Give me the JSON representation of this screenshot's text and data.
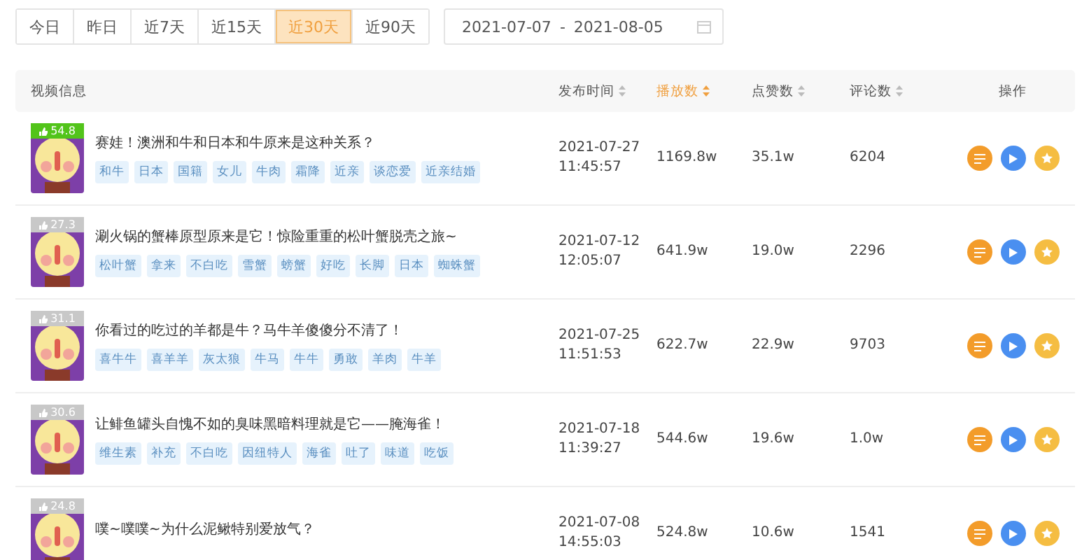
{
  "range_tabs": [
    {
      "label": "今日",
      "selected": false
    },
    {
      "label": "昨日",
      "selected": false
    },
    {
      "label": "近7天",
      "selected": false
    },
    {
      "label": "近15天",
      "selected": false
    },
    {
      "label": "近30天",
      "selected": true
    },
    {
      "label": "近90天",
      "selected": false
    }
  ],
  "date_range": {
    "start": "2021-07-07",
    "separator": "-",
    "end": "2021-08-05"
  },
  "table": {
    "columns": [
      {
        "label": "视频信息",
        "sortable": false,
        "selected": false
      },
      {
        "label": "发布时间",
        "sortable": true,
        "selected": false
      },
      {
        "label": "播放数",
        "sortable": true,
        "selected": true
      },
      {
        "label": "点赞数",
        "sortable": true,
        "selected": false
      },
      {
        "label": "评论数",
        "sortable": true,
        "selected": false
      },
      {
        "label": "操作",
        "sortable": false,
        "selected": false
      }
    ],
    "rows": [
      {
        "score": "54.8",
        "color": "#52c41a",
        "title": "赛娃！澳洲和牛和日本和牛原来是这种关系？",
        "tags": [
          "和牛",
          "日本",
          "国籍",
          "女儿",
          "牛肉",
          "霜降",
          "近亲",
          "谈恋爱",
          "近亲结婚"
        ],
        "date": "2021-07-27",
        "time": "11:45:57",
        "plays": "1169.8w",
        "likes": "35.1w",
        "comments": "6204"
      },
      {
        "score": "27.3",
        "color": "#c8c8c8",
        "title": "涮火锅的蟹棒原型原来是它！惊险重重的松叶蟹脱壳之旅~",
        "tags": [
          "松叶蟹",
          "拿来",
          "不白吃",
          "雪蟹",
          "螃蟹",
          "好吃",
          "长脚",
          "日本",
          "蜘蛛蟹"
        ],
        "date": "2021-07-12",
        "time": "12:05:07",
        "plays": "641.9w",
        "likes": "19.0w",
        "comments": "2296"
      },
      {
        "score": "31.1",
        "color": "#c8c8c8",
        "title": "你看过的吃过的羊都是牛？马牛羊傻傻分不清了！",
        "tags": [
          "喜牛牛",
          "喜羊羊",
          "灰太狼",
          "牛马",
          "牛牛",
          "勇敢",
          "羊肉",
          "牛羊"
        ],
        "date": "2021-07-25",
        "time": "11:51:53",
        "plays": "622.7w",
        "likes": "22.9w",
        "comments": "9703"
      },
      {
        "score": "30.6",
        "color": "#c8c8c8",
        "title": "让鲱鱼罐头自愧不如的臭味黑暗料理就是它——腌海雀！",
        "tags": [
          "维生素",
          "补充",
          "不白吃",
          "因纽特人",
          "海雀",
          "吐了",
          "味道",
          "吃饭"
        ],
        "date": "2021-07-18",
        "time": "11:39:27",
        "plays": "544.6w",
        "likes": "19.6w",
        "comments": "1.0w"
      },
      {
        "score": "24.8",
        "color": "#c8c8c8",
        "title": "噗~噗噗~为什么泥鳅特别爱放气？",
        "tags": [],
        "date": "2021-07-08",
        "time": "14:55:03",
        "plays": "524.8w",
        "likes": "10.6w",
        "comments": "1541"
      }
    ]
  }
}
